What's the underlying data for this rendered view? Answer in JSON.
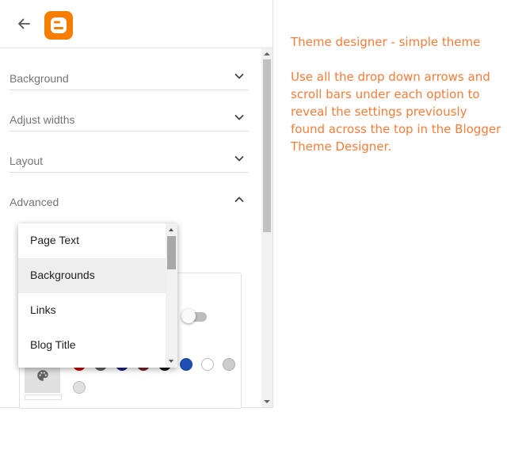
{
  "header": {
    "back_icon": "arrow-left-icon",
    "logo_icon": "blogger-logo-icon",
    "logo_color": "#f57d00"
  },
  "sections": [
    {
      "label": "Background",
      "expanded": false
    },
    {
      "label": "Adjust widths",
      "expanded": false
    },
    {
      "label": "Layout",
      "expanded": false
    },
    {
      "label": "Advanced",
      "expanded": true
    }
  ],
  "advanced": {
    "dropdown": {
      "selected": "Backgrounds",
      "options": [
        "Page Text",
        "Backgrounds",
        "Links",
        "Blog Title"
      ]
    },
    "toggle_on": false,
    "palette_icon": "palette-icon",
    "swatches": [
      {
        "color": "#cc0000",
        "selected": false
      },
      {
        "color": "#616161",
        "selected": false
      },
      {
        "color": "#1a237e",
        "selected": false
      },
      {
        "color": "#7b1f2d",
        "selected": false
      },
      {
        "color": "#111111",
        "selected": false
      },
      {
        "color": "#1e4fb4",
        "selected": false
      },
      {
        "color": "#ffffff",
        "selected": false
      },
      {
        "color": "#cccccc",
        "selected": false
      },
      {
        "color": "#e0e0e0",
        "selected": false
      }
    ]
  },
  "annotation": {
    "heading": "Theme designer - simple theme",
    "body": "Use all the drop down arrows and scroll bars under each option to reveal the settings previously found across the top in the Blogger Theme Designer.",
    "color": "#f57d3a"
  }
}
